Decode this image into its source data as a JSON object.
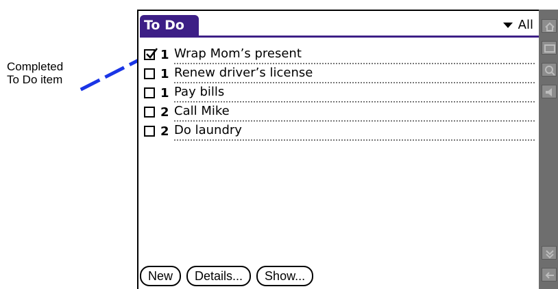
{
  "callout": {
    "line1": "Completed",
    "line2": "To Do item"
  },
  "app": {
    "title": "To Do",
    "category": "All",
    "accent_color": "#3d1f86"
  },
  "items": [
    {
      "checked": true,
      "priority": "1",
      "description": "Wrap Mom’s present"
    },
    {
      "checked": false,
      "priority": "1",
      "description": "Renew driver’s license"
    },
    {
      "checked": false,
      "priority": "1",
      "description": "Pay bills"
    },
    {
      "checked": false,
      "priority": "2",
      "description": "Call Mike"
    },
    {
      "checked": false,
      "priority": "2",
      "description": "Do laundry"
    }
  ],
  "buttons": {
    "new": "New",
    "details": "Details...",
    "show": "Show..."
  },
  "sidebar_icons": [
    "home-icon",
    "menu-icon",
    "find-icon",
    "speaker-icon",
    "scroll-icon",
    "back-icon"
  ]
}
